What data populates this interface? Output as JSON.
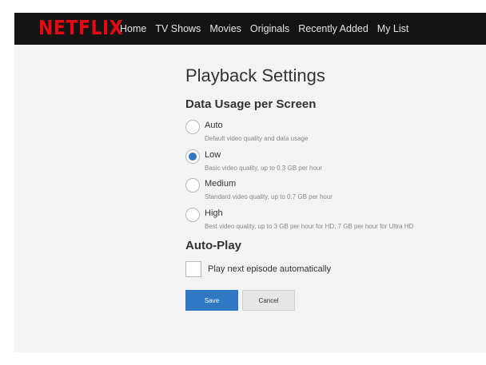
{
  "header": {
    "logo": "NETFLIX",
    "nav": [
      "Home",
      "TV Shows",
      "Movies",
      "Originals",
      "Recently Added",
      "My List"
    ]
  },
  "page": {
    "title": "Playback Settings",
    "data_usage_title": "Data Usage per Screen",
    "options": [
      {
        "label": "Auto",
        "description": "Default video quality and data usage",
        "selected": false
      },
      {
        "label": "Low",
        "description": "Basic video quality, up to 0.3 GB per hour",
        "selected": true
      },
      {
        "label": "Medium",
        "description": "Standard video quality, up to 0.7 GB per hour",
        "selected": false
      },
      {
        "label": "High",
        "description": "Best video quality, up to 3 GB per hour for HD, 7 GB per hour for Ultra HD",
        "selected": false
      }
    ],
    "autoplay_title": "Auto-Play",
    "autoplay_label": "Play next episode automatically",
    "autoplay_checked": false,
    "save_label": "Save",
    "cancel_label": "Cancel"
  },
  "colors": {
    "brand": "#e50914",
    "accent": "#2f78c4",
    "header_bg": "#141414",
    "page_bg": "#f3f3f3"
  }
}
